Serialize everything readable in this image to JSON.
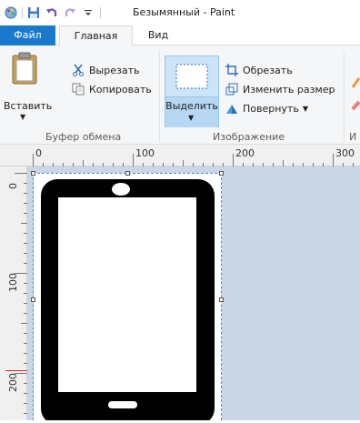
{
  "window": {
    "title": "Безымянный - Paint"
  },
  "tabs": {
    "file": "Файл",
    "home": "Главная",
    "view": "Вид"
  },
  "clipboard": {
    "paste": "Вставить",
    "cut": "Вырезать",
    "copy": "Копировать",
    "group_label": "Буфер обмена"
  },
  "image": {
    "select": "Выделить",
    "crop": "Обрезать",
    "resize": "Изменить размер",
    "rotate": "Повернуть",
    "group_label": "Изображение"
  },
  "tools": {
    "group_label_partial": "И"
  },
  "ruler": {
    "h_labels": [
      "0",
      "100",
      "200",
      "300"
    ],
    "v_labels": [
      "0",
      "100",
      "200"
    ]
  },
  "icons": {
    "app": "paint-app-icon",
    "save": "save-icon",
    "undo": "undo-icon",
    "redo": "redo-icon",
    "customize": "customize-quick-access-icon",
    "paste": "clipboard-paste-icon",
    "cut": "scissors-icon",
    "copy": "copy-icon",
    "select": "selection-rectangle-icon",
    "crop": "crop-icon",
    "resize": "resize-icon",
    "rotate": "rotate-icon"
  },
  "colors": {
    "file_tab": "#1979ca",
    "ribbon_bg": "#f5f6f7",
    "workspace_bg": "#cad6e5",
    "select_active": "#cce4f7"
  },
  "drawing": {
    "subject": "smartphone-drawing"
  }
}
